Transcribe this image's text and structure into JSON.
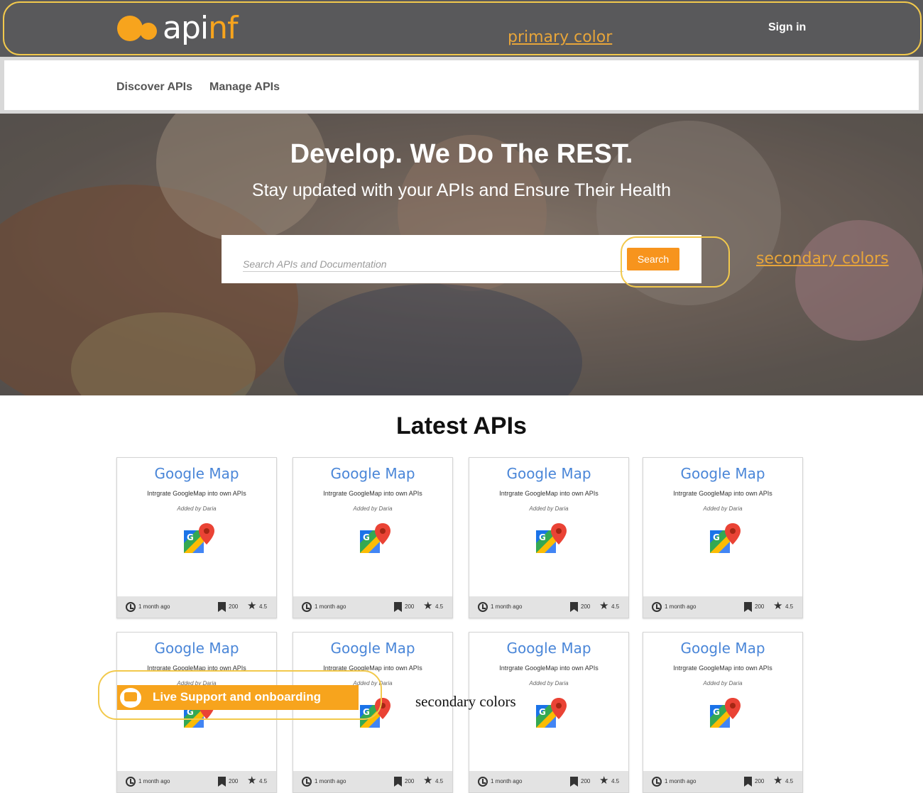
{
  "header": {
    "logo_api": "api",
    "logo_nf": "nf",
    "annotation": "primary color",
    "signin_label": "Sign in"
  },
  "nav": {
    "items": [
      "Discover APIs",
      "Manage APIs"
    ]
  },
  "hero": {
    "title": "Develop. We Do The REST.",
    "subtitle": "Stay updated with your APIs and Ensure Their Health",
    "search_placeholder": "Search APIs and Documentation",
    "search_button": "Search",
    "annotation": "secondary colors"
  },
  "latest": {
    "title": "Latest APIs",
    "cards": [
      {
        "title": "Google Map",
        "desc": "Intrgrate GoogleMap into own APIs",
        "by": "Added by Daria",
        "time": "1 month ago",
        "bookmarks": "200",
        "rating": "4.5"
      },
      {
        "title": "Google Map",
        "desc": "Intrgrate GoogleMap into own APIs",
        "by": "Added by Daria",
        "time": "1 month ago",
        "bookmarks": "200",
        "rating": "4.5"
      },
      {
        "title": "Google Map",
        "desc": "Intrgrate GoogleMap into own APIs",
        "by": "Added by Daria",
        "time": "1 month ago",
        "bookmarks": "200",
        "rating": "4.5"
      },
      {
        "title": "Google Map",
        "desc": "Intrgrate GoogleMap into own APIs",
        "by": "Added by Daria",
        "time": "1 month ago",
        "bookmarks": "200",
        "rating": "4.5"
      },
      {
        "title": "Google Map",
        "desc": "Intrgrate GoogleMap into own APIs",
        "by": "Added by Daria",
        "time": "1 month ago",
        "bookmarks": "200",
        "rating": "4.5"
      },
      {
        "title": "Google Map",
        "desc": "Intrgrate GoogleMap into own APIs",
        "by": "Added by Daria",
        "time": "1 month ago",
        "bookmarks": "200",
        "rating": "4.5"
      },
      {
        "title": "Google Map",
        "desc": "Intrgrate GoogleMap into own APIs",
        "by": "Added by Daria",
        "time": "1 month ago",
        "bookmarks": "200",
        "rating": "4.5"
      },
      {
        "title": "Google Map",
        "desc": "Intrgrate GoogleMap into own APIs",
        "by": "Added by Daria",
        "time": "1 month ago",
        "bookmarks": "200",
        "rating": "4.5"
      }
    ]
  },
  "live_support": {
    "label": "Live Support and onboarding",
    "annotation": "secondary colors"
  },
  "colors": {
    "header_bg": "#59595b",
    "brand_orange": "#f7a41d",
    "search_button": "#f7941d",
    "card_title": "#4a86d8",
    "annotation_ring": "#f2c94c"
  },
  "icons": [
    "clock-icon",
    "bookmark-icon",
    "star-icon",
    "google-maps-icon",
    "chat-icon"
  ]
}
